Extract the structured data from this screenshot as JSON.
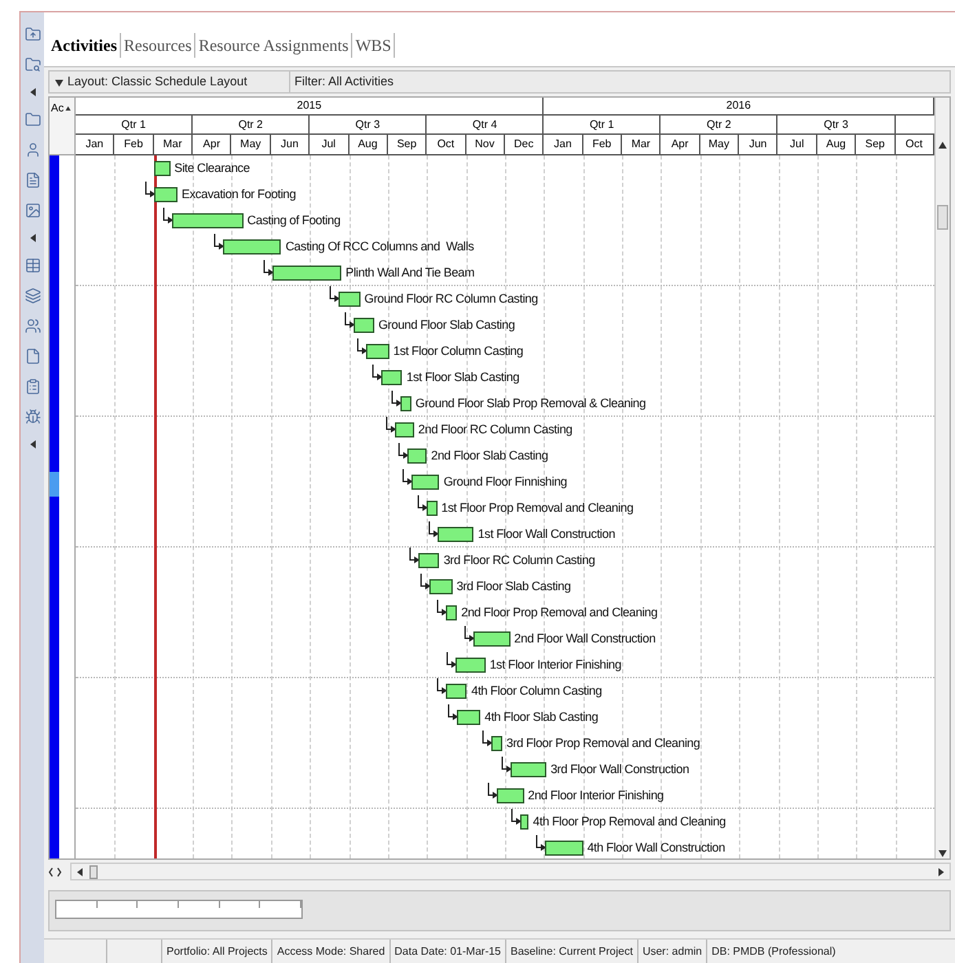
{
  "tabs": [
    {
      "label": "Activities",
      "selected": true
    },
    {
      "label": "Resources",
      "selected": false
    },
    {
      "label": "Resource Assignments",
      "selected": false
    },
    {
      "label": "WBS",
      "selected": false
    }
  ],
  "layout_bar": {
    "layout": "Layout: Classic Schedule Layout",
    "filter": "Filter: All Activities"
  },
  "gantt": {
    "column_header": "Ac",
    "years": [
      {
        "label": "2015",
        "quarters": [
          "Qtr 1",
          "Qtr 2",
          "Qtr 3",
          "Qtr 4"
        ]
      },
      {
        "label": "2016",
        "quarters": [
          "Qtr 1",
          "Qtr 2",
          "Qtr 3"
        ]
      }
    ],
    "months": [
      "Jan",
      "Feb",
      "Mar",
      "Apr",
      "May",
      "Jun",
      "Jul",
      "Aug",
      "Sep",
      "Oct",
      "Nov",
      "Dec",
      "Jan",
      "Feb",
      "Mar",
      "Apr",
      "May",
      "Jun",
      "Jul",
      "Aug",
      "Sep",
      "Oct"
    ],
    "activities": [
      "Site Clearance",
      "Excavation for Footing",
      "Casting of Footing",
      "Casting Of RCC Columns and  Walls",
      "Plinth Wall And Tie Beam",
      "Ground Floor RC Column Casting",
      "Ground Floor Slab Casting",
      "1st Floor Column Casting",
      "1st Floor Slab Casting",
      "Ground Floor Slab Prop Removal & Cleaning",
      "2nd Floor RC Column Casting",
      "2nd Floor Slab Casting",
      "Ground Floor Finnishing",
      "1st Floor Prop Removal and Cleaning",
      "1st Floor Wall Construction",
      "3rd Floor RC Column Casting",
      "3rd Floor Slab Casting",
      "2nd Floor Prop Removal and Cleaning",
      "2nd Floor Wall Construction",
      "1st Floor Interior Finishing",
      "4th Floor Column Casting",
      "4th Floor Slab Casting",
      "3rd Floor Prop Removal and Cleaning",
      "3rd Floor Wall Construction",
      "2nd Floor Interior Finishing",
      "4th Floor Prop Removal and Cleaning",
      "4th Floor Wall Construction"
    ]
  },
  "status_bar": [
    "Portfolio: All Projects",
    "Access Mode: Shared",
    "Data Date: 01-Mar-15",
    "Baseline: Current Project",
    "User: admin",
    "DB: PMDB (Professional)"
  ]
}
